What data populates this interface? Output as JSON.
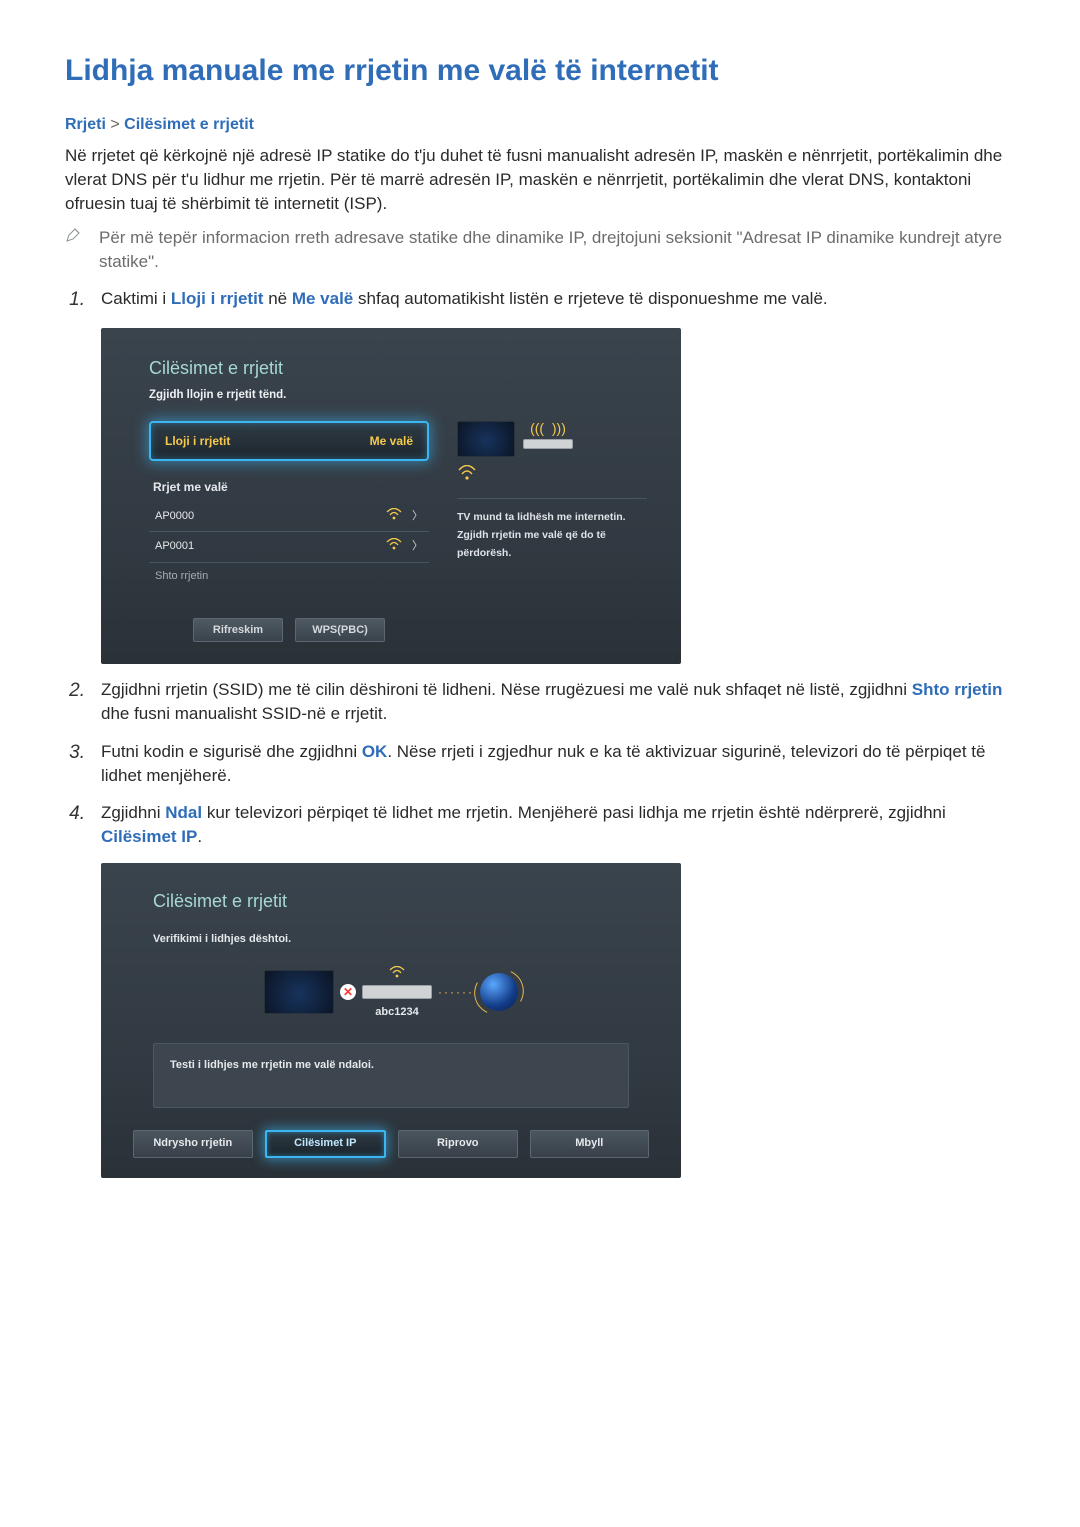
{
  "title": "Lidhja manuale me rrjetin me valë të internetit",
  "breadcrumb": {
    "a": "Rrjeti",
    "sep": ">",
    "b": "Cilësimet e rrjetit"
  },
  "intro": "Në rrjetet që kërkojnë një adresë IP statike do t'ju duhet të fusni manualisht adresën IP, maskën e nënrrjetit, portëkalimin dhe vlerat DNS për t'u lidhur me rrjetin. Për të marrë adresën IP, maskën e nënrrjetit, portëkalimin dhe vlerat DNS, kontaktoni ofruesin tuaj të shërbimit të internetit (ISP).",
  "note": "Për më tepër informacion rreth adresave statike dhe dinamike IP, drejtojuni seksionit \"Adresat IP dinamike kundrejt atyre statike\".",
  "steps": [
    {
      "num": "1.",
      "pre": "Caktimi i ",
      "kw1": "Lloji i rrjetit",
      "mid": " në ",
      "kw2": "Me valë",
      "post": " shfaq automatikisht listën e rrjeteve të disponueshme me valë."
    },
    {
      "num": "2.",
      "pre": "Zgjidhni rrjetin (SSID) me të cilin dëshironi të lidheni. Nëse rrugëzuesi me valë nuk shfaqet në listë, zgjidhni ",
      "kw1": "Shto rrjetin",
      "post": " dhe fusni manualisht SSID-në e rrjetit."
    },
    {
      "num": "3.",
      "pre": "Futni kodin e sigurisë dhe zgjidhni ",
      "kw1": "OK",
      "post": ". Nëse rrjeti i zgjedhur nuk e ka të aktivizuar sigurinë, televizori do të përpiqet të lidhet menjëherë."
    },
    {
      "num": "4.",
      "pre": "Zgjidhni ",
      "kw1": "Ndal",
      "mid": " kur televizori përpiqet të lidhet me rrjetin. Menjëherë pasi lidhja me rrjetin është ndërprerë, zgjidhni ",
      "kw2": "Cilësimet IP",
      "post": "."
    }
  ],
  "shot1": {
    "title": "Cilësimet e rrjetit",
    "sub": "Zgjidh llojin e rrjetit tënd.",
    "dropdown": {
      "label": "Lloji i rrjetit",
      "value": "Me valë"
    },
    "group": "Rrjet me valë",
    "rows": [
      {
        "name": "AP0000",
        "hasIcons": true
      },
      {
        "name": "AP0001",
        "hasIcons": true
      },
      {
        "name": "Shto rrjetin",
        "hasIcons": false
      }
    ],
    "buttons": {
      "refresh": "Rifreskim",
      "wps": "WPS(PBC)"
    },
    "right": [
      "TV mund ta lidhësh me internetin.",
      "Zgjidh rrjetin me valë që do të",
      "përdorësh."
    ]
  },
  "shot2": {
    "title": "Cilësimet e rrjetit",
    "fail": "Verifikimi i lidhjes dështoi.",
    "ssid": "abc1234",
    "msg": "Testi i lidhjes me rrjetin me valë ndaloi.",
    "buttons": {
      "change": "Ndrysho rrjetin",
      "ip": "Cilësimet IP",
      "retry": "Riprovo",
      "close": "Mbyll"
    }
  }
}
